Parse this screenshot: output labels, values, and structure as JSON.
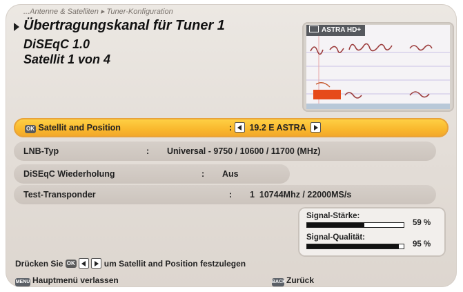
{
  "header": {
    "breadcrumb": "...Antenne & Satelliten ▸ Tuner-Konfiguration",
    "title": "Übertragungskanal für Tuner 1",
    "line2": "DiSEqC 1.0",
    "line3": "Satellit 1 von 4"
  },
  "preview": {
    "channel": "ASTRA HD+",
    "icon": "tv-icon"
  },
  "settings": [
    {
      "label": "Satellit and Position",
      "value": "19.2 E ASTRA",
      "icon": "ok-key-icon"
    },
    {
      "label": "LNB-Typ",
      "value": "Universal - 9750 / 10600 / 11700 (MHz)"
    },
    {
      "label": "DiSEqC Wiederholung",
      "value": "Aus"
    },
    {
      "label": "Test-Transponder",
      "value": "1  10744Mhz / 22000MS/s"
    }
  ],
  "separator": ":",
  "signal": {
    "strength_label": "Signal-Stärke:",
    "strength_value": 59,
    "strength_text": "59 %",
    "quality_label": "Signal-Qualität:",
    "quality_value": 95,
    "quality_text": "95 %"
  },
  "hint": {
    "prefix": "Drücken Sie",
    "ok_key": "OK",
    "suffix": "um Satellit and Position festzulegen"
  },
  "footer": {
    "menu_key": "MENU",
    "menu_label": "Hauptmenü verlassen",
    "back_key": "BACK",
    "back_label": "Zurück"
  },
  "colors": {
    "highlight": "#f9b72d",
    "panel": "#e3ddd7"
  }
}
